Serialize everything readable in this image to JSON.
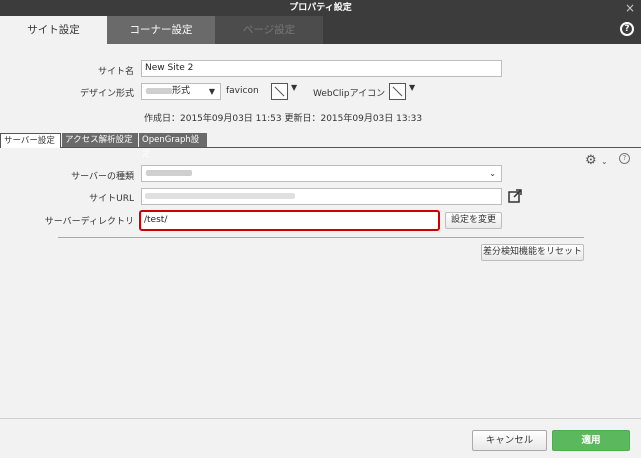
{
  "window": {
    "title": "プロパティ設定",
    "close": "×"
  },
  "tabs": [
    {
      "label": "サイト設定"
    },
    {
      "label": "コーナー設定"
    },
    {
      "label": "ページ設定"
    }
  ],
  "help": "?",
  "site": {
    "name_label": "サイト名",
    "name_value": "New Site 2",
    "design_label": "デザイン形式",
    "design_value": "形式",
    "favicon_label": "favicon",
    "webclip_label": "WebClipアイコン",
    "info": "作成日：2015年09月03日 11:53 更新日：2015年09月03日 13:33"
  },
  "subtabs": [
    {
      "label": "サーバー設定"
    },
    {
      "label": "アクセス解析設定"
    },
    {
      "label": "OpenGraph設定"
    }
  ],
  "server": {
    "type_label": "サーバーの種類",
    "url_label": "サイトURL",
    "dir_label": "サーバーディレクトリ",
    "dir_value": "/test/",
    "change_button": "設定を変更",
    "reset_button": "差分検知機能をリセット"
  },
  "footer": {
    "cancel": "キャンセル",
    "apply": "適用"
  },
  "colors": {
    "highlight": "#cc0000",
    "apply": "#5cb85c",
    "titlebar": "#3c3c3c"
  },
  "icons": {
    "gear": "gear-icon",
    "external": "external-link-icon",
    "help": "help-icon"
  }
}
